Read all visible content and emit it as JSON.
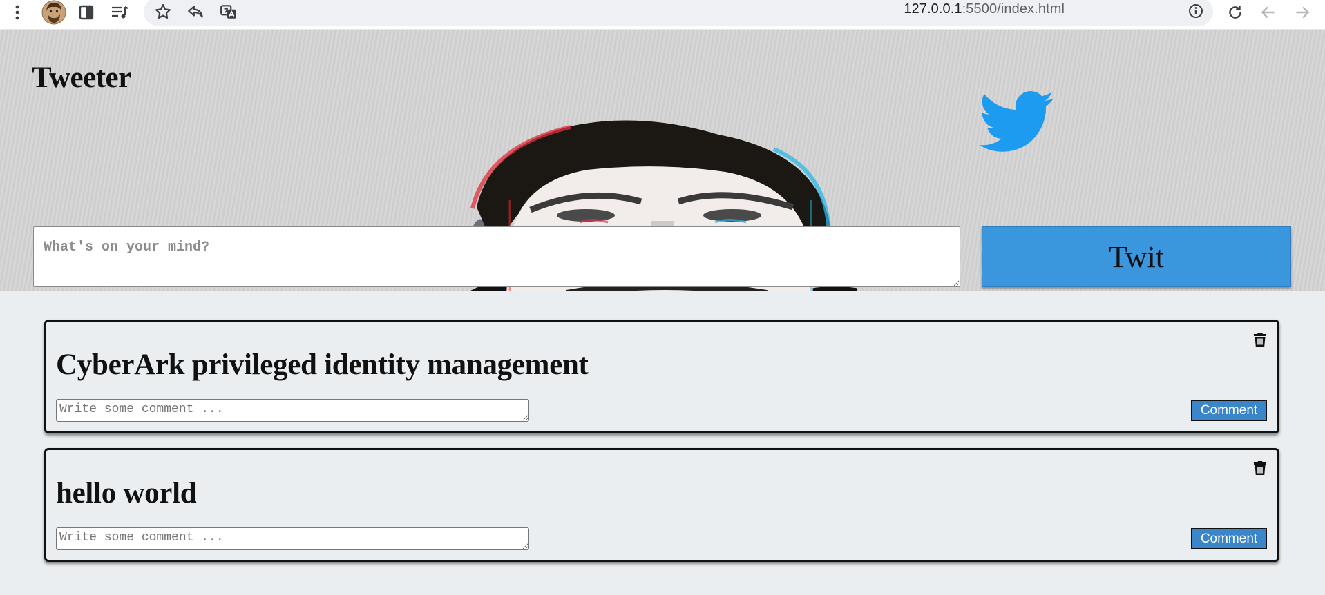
{
  "browser": {
    "url_host": "127.0.0.1",
    "url_path": ":5500/index.html"
  },
  "header": {
    "title": "Tweeter"
  },
  "composer": {
    "placeholder": "What's on your mind?",
    "button_label": "Twit"
  },
  "tweets": [
    {
      "text": "CyberArk privileged identity management",
      "comment_placeholder": "Write some comment ...",
      "comment_button": "Comment"
    },
    {
      "text": "hello world",
      "comment_placeholder": "Write some comment ...",
      "comment_button": "Comment"
    }
  ],
  "colors": {
    "twitter_blue": "#1d9bf0",
    "button_blue": "#3a96dd",
    "page_background": "#eaeef0"
  }
}
